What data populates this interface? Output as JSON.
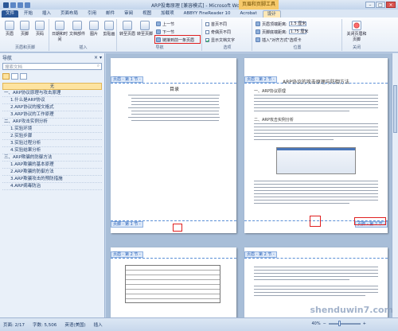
{
  "window": {
    "title": "ARP投毒原理 [兼容模式] - Microsoft Word",
    "context_title": "页眉和页脚工具"
  },
  "ribbon_tabs": [
    "文件",
    "开始",
    "插入",
    "页面布局",
    "引用",
    "邮件",
    "审阅",
    "视图",
    "加载项",
    "ABBYY FineReader 10",
    "Acrobat",
    "设计"
  ],
  "ribbon": {
    "g1": {
      "label": "页眉和页脚",
      "btn1": "页眉",
      "btn2": "页脚",
      "btn3": "页码"
    },
    "g2": {
      "label": "插入",
      "btn1": "日期和时间",
      "btn2": "文档部件",
      "btn3": "图片",
      "btn4": "剪贴画"
    },
    "g3": {
      "label": "导航",
      "btn1": "转至页眉",
      "btn2": "转至页脚",
      "opt1": "上一节",
      "opt2": "下一节",
      "opt3": "链接到前一条页眉"
    },
    "g4": {
      "label": "选项",
      "opt1": "首页不同",
      "opt2": "奇偶页不同",
      "opt3": "显示文档文字"
    },
    "g5": {
      "label": "位置",
      "opt1": "页眉顶端距离:",
      "val1": "1.5 厘米",
      "opt2": "页脚底端距离:",
      "val2": "1.75 厘米",
      "opt3": "插入\"对齐方式\"选项卡"
    },
    "g6": {
      "label": "关闭",
      "btn1": "关闭页眉和页脚"
    }
  },
  "nav": {
    "title": "导航",
    "search_placeholder": "搜索文档",
    "items": [
      {
        "text": "无",
        "level": "sel"
      },
      {
        "text": "一、ARP协议原理与攻击原理",
        "level": "l1"
      },
      {
        "text": "1.什么是ARP协议",
        "level": "l2"
      },
      {
        "text": "2.ARP协议的报文格式",
        "level": "l2"
      },
      {
        "text": "3.ARP协议的工作原理",
        "level": "l2"
      },
      {
        "text": "二、ARP攻击实例分析",
        "level": "l1"
      },
      {
        "text": "1.实验环境",
        "level": "l2"
      },
      {
        "text": "2.实验步骤",
        "level": "l2"
      },
      {
        "text": "3.实验过程分析",
        "level": "l2"
      },
      {
        "text": "4.实验结果分析",
        "level": "l2"
      },
      {
        "text": "三、ARP欺骗的防御方法",
        "level": "l1"
      },
      {
        "text": "1.ARP欺骗的基本原理",
        "level": "l2"
      },
      {
        "text": "2.ARP欺骗的防御方法",
        "level": "l2"
      },
      {
        "text": "3.ARP欺骗攻击的预防措施",
        "level": "l2"
      },
      {
        "text": "4.ARP病毒防治",
        "level": "l2"
      }
    ]
  },
  "pages": {
    "p1": {
      "header": "页眉 - 第 1 节 -",
      "footer": "页脚 - 第 1 节 -",
      "toc": "目录"
    },
    "p2": {
      "header": "页眉 - 第 2 节 -",
      "footer": "页脚 - 第 2 节 -",
      "title": "ARP协议的攻击原理与防御方法",
      "h1": "一、ARP协议原理",
      "h2": "二、ARP攻击实例分析"
    },
    "p3": {
      "header": "页眉 - 第 2 节 -"
    },
    "p4": {
      "header": "页眉 - 第 2 节 -"
    }
  },
  "status": {
    "page": "页面: 2/17",
    "words": "字数: 5,506",
    "lang": "英语(美国)",
    "mode": "插入",
    "zoom": "40%"
  },
  "watermark": "shenduwin7.com"
}
